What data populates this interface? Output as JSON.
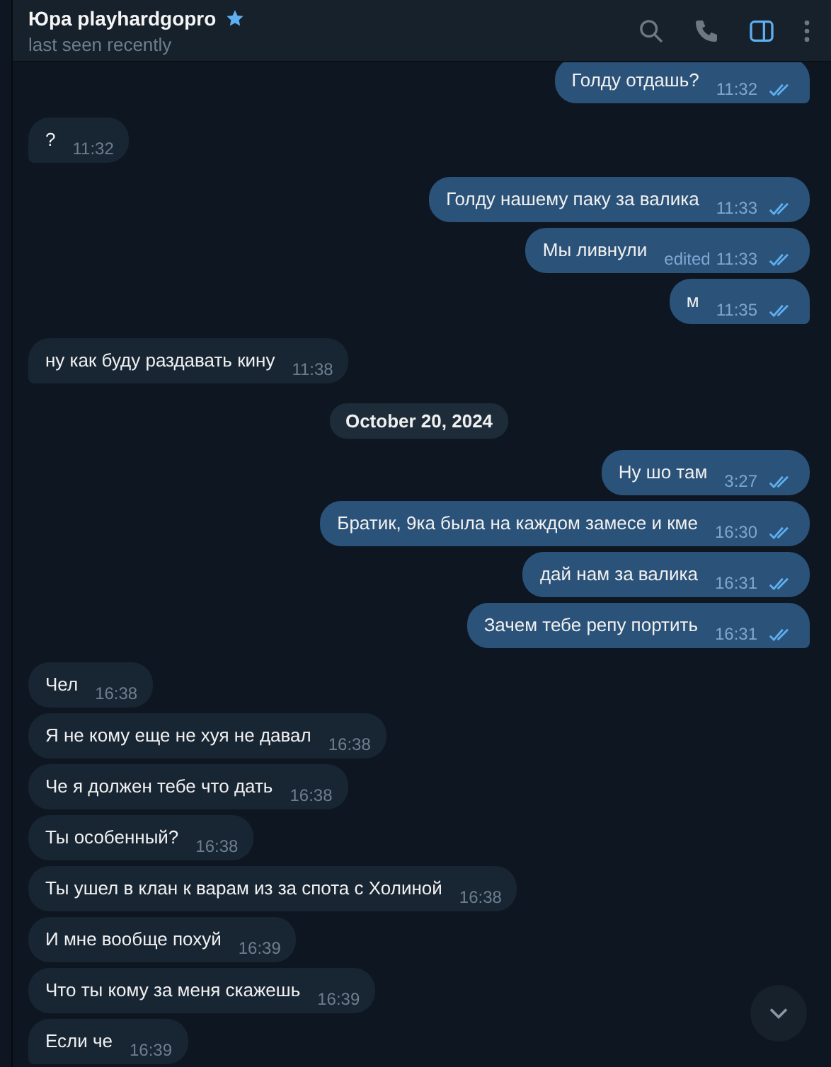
{
  "header": {
    "name": "Юра playhardgopro",
    "status": "last seen recently"
  },
  "messages": [
    {
      "kind": "outgoing",
      "text": "Голду отдашь?",
      "time": "11:32",
      "read": true
    },
    {
      "kind": "incoming",
      "text": "?",
      "time": "11:32"
    },
    {
      "kind": "outgoing",
      "text": "Голду нашему паку за валика",
      "time": "11:33",
      "read": true
    },
    {
      "kind": "outgoing",
      "text": "Мы ливнули",
      "edited": "edited",
      "time": "11:33",
      "read": true
    },
    {
      "kind": "outgoing",
      "text": "м",
      "time": "11:35",
      "read": true
    },
    {
      "kind": "incoming",
      "text": "ну как буду раздавать кину",
      "time": "11:38"
    },
    {
      "kind": "date",
      "text": "October 20, 2024"
    },
    {
      "kind": "outgoing",
      "text": "Ну шо там",
      "time": "3:27",
      "read": true
    },
    {
      "kind": "outgoing",
      "text": "Братик, 9ка была на каждом замесе и кме",
      "time": "16:30",
      "read": true
    },
    {
      "kind": "outgoing",
      "text": "дай нам за валика",
      "time": "16:31",
      "read": true
    },
    {
      "kind": "outgoing",
      "text": "Зачем тебе репу портить",
      "time": "16:31",
      "read": true
    },
    {
      "kind": "incoming",
      "text": "Чел",
      "time": "16:38"
    },
    {
      "kind": "incoming",
      "text": "Я не кому еще не хуя не давал",
      "time": "16:38"
    },
    {
      "kind": "incoming",
      "text": "Че я должен тебе что дать",
      "time": "16:38"
    },
    {
      "kind": "incoming",
      "text": "Ты особенный?",
      "time": "16:38"
    },
    {
      "kind": "incoming",
      "text": "Ты ушел в клан к варам из за спота с Холиной",
      "time": "16:38"
    },
    {
      "kind": "incoming",
      "text": "И мне вообще похуй",
      "time": "16:39"
    },
    {
      "kind": "incoming",
      "text": "Что ты кому за меня скажешь",
      "time": "16:39"
    },
    {
      "kind": "incoming",
      "text": "Если че",
      "time": "16:39"
    }
  ]
}
